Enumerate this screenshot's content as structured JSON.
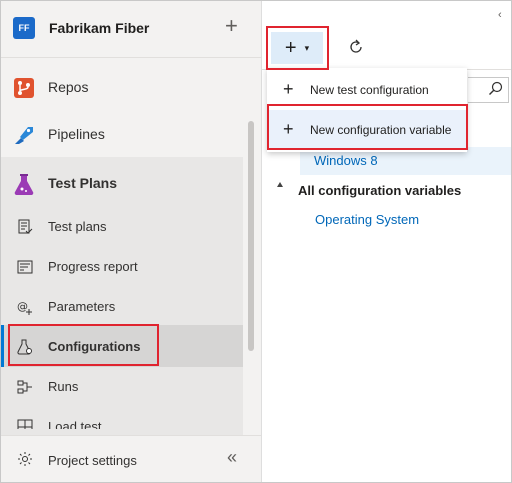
{
  "organization": {
    "logo_text": "FF",
    "name": "Fabrikam Fiber",
    "add_symbol": "+"
  },
  "sidebar": {
    "items": [
      {
        "label": "Repos",
        "icon": "repos-icon"
      },
      {
        "label": "Pipelines",
        "icon": "pipelines-icon"
      },
      {
        "label": "Test Plans",
        "icon": "test-plans-icon"
      },
      {
        "label": "Test plans",
        "icon": "test-plans-list-icon"
      },
      {
        "label": "Progress report",
        "icon": "progress-report-icon"
      },
      {
        "label": "Parameters",
        "icon": "parameters-icon"
      },
      {
        "label": "Configurations",
        "icon": "configurations-icon"
      },
      {
        "label": "Runs",
        "icon": "runs-icon"
      },
      {
        "label": "Load test",
        "icon": "load-test-icon"
      }
    ],
    "footer": {
      "label": "Project settings",
      "collapse_symbol": "«"
    }
  },
  "toolbar": {
    "add_symbol": "+",
    "caret": "▾",
    "chevron": "‹"
  },
  "dropdown": {
    "items": [
      {
        "label": "New test configuration",
        "symbol": "+"
      },
      {
        "label": "New configuration variable",
        "symbol": "+"
      }
    ]
  },
  "content": {
    "selected_item": "Windows 8",
    "group_title": "All configuration variables",
    "group_items": [
      "Operating System"
    ]
  },
  "colors": {
    "accent": "#0067b8",
    "highlight": "#e0242f",
    "brand": "#1b6ac9"
  }
}
